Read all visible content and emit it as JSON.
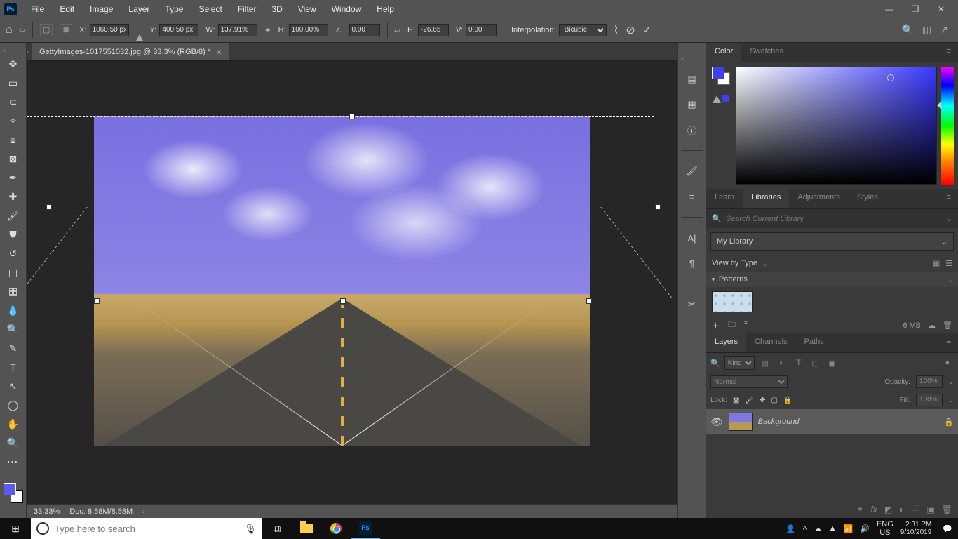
{
  "menu": [
    "File",
    "Edit",
    "Image",
    "Layer",
    "Type",
    "Select",
    "Filter",
    "3D",
    "View",
    "Window",
    "Help"
  ],
  "options": {
    "x_label": "X:",
    "x": "1060.50 px",
    "y_label": "Y:",
    "y": "400.50 px",
    "w_label": "W:",
    "w": "137.91%",
    "h_label": "H:",
    "h": "100.00%",
    "rot": "0.00",
    "skew_h_label": "H:",
    "skew_h": "-26.65",
    "skew_v_label": "V:",
    "skew_v": "0.00",
    "interp_label": "Interpolation:",
    "interp": "Bicubic"
  },
  "doc": {
    "tab": "GettyImages-1017551032.jpg @ 33.3% (RGB/8) *",
    "zoom": "33.33%",
    "docinfo": "Doc: 8.58M/8.58M"
  },
  "panels": {
    "color": {
      "tab1": "Color",
      "tab2": "Swatches"
    },
    "mid": {
      "t1": "Learn",
      "t2": "Libraries",
      "t3": "Adjustments",
      "t4": "Styles"
    },
    "lib": {
      "search_ph": "Search Current Library",
      "select": "My Library",
      "view": "View by Type",
      "section": "Patterns",
      "size": "6 MB"
    },
    "layers": {
      "t1": "Layers",
      "t2": "Channels",
      "t3": "Paths",
      "kind": "Kind",
      "mode": "Normal",
      "opacity_l": "Opacity:",
      "opacity": "100%",
      "lock": "Lock:",
      "fill_l": "Fill:",
      "fill": "100%",
      "layer1": "Background"
    }
  },
  "taskbar": {
    "search_ph": "Type here to search",
    "lang1": "ENG",
    "lang2": "US",
    "time": "2:31 PM",
    "date": "9/10/2019"
  }
}
